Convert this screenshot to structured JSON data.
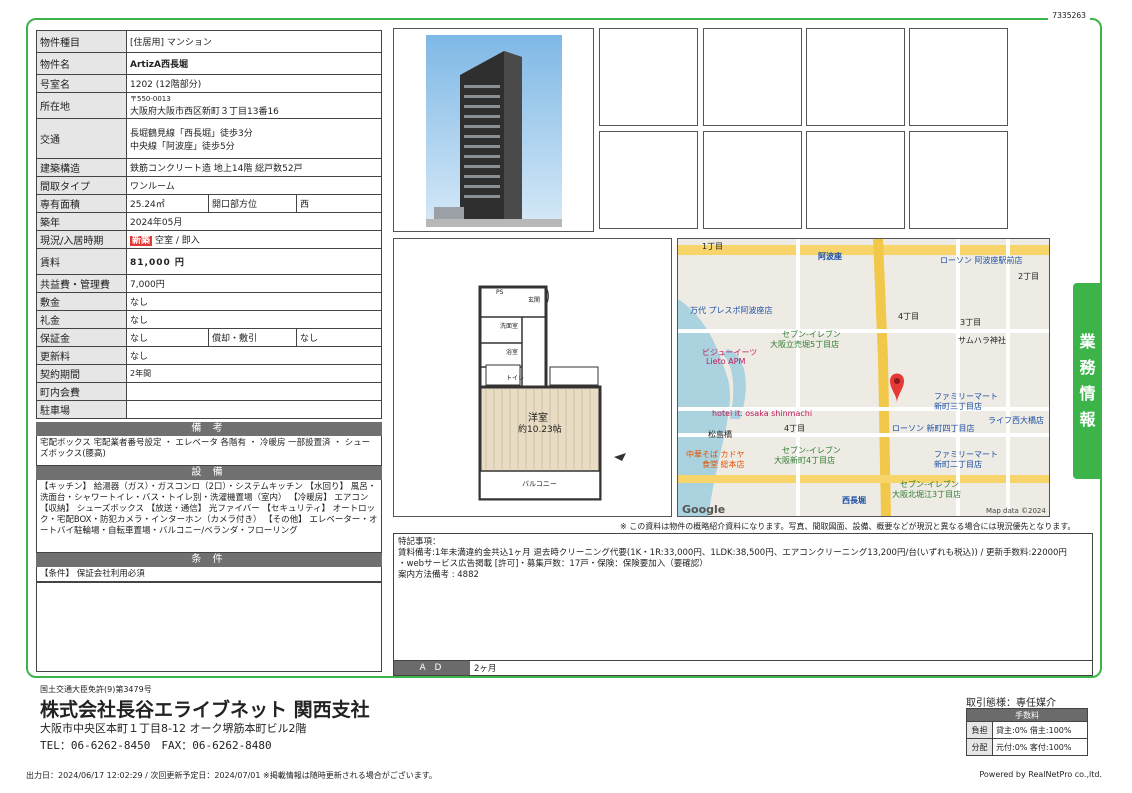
{
  "doc_id": "7335263",
  "property": {
    "type_label": "物件種目",
    "type_value": "[住居用] マンション",
    "name_label": "物件名",
    "name_value": "ArtizA西長堀",
    "room_label": "号室名",
    "room_value": "1202 (12階部分)",
    "address_label": "所在地",
    "postal": "〒550-0013",
    "address_value": "大阪府大阪市西区新町３丁目13番16",
    "access_label": "交通",
    "access_1": "長堀鶴見線「西長堀」徒歩3分",
    "access_2": "中央線「阿波座」徒歩5分",
    "structure_label": "建築構造",
    "structure_value": "鉄筋コンクリート造 地上14階 総戸数52戸",
    "layout_label": "間取タイプ",
    "layout_value": "ワンルーム",
    "area_label": "専有面積",
    "area_value": "25.24㎡",
    "orient_label": "開口部方位",
    "orient_value": "西",
    "built_label": "築年",
    "built_value": "2024年05月",
    "status_label": "現況/入居時期",
    "new_badge": "新築",
    "status_value": "空室 / 即入",
    "rent_label": "賃料",
    "rent_value": "81,000 円",
    "mgmt_label": "共益費・管理費",
    "mgmt_value": "7,000円",
    "deposit_label": "敷金",
    "deposit_value": "なし",
    "key_label": "礼金",
    "key_value": "なし",
    "guarantee_label": "保証金",
    "guarantee_value": "なし",
    "amort_label": "償却・敷引",
    "amort_value": "なし",
    "renewal_label": "更新料",
    "renewal_value": "なし",
    "contract_label": "契約期間",
    "contract_value": "2年間",
    "assoc_label": "町内会費",
    "assoc_value": "",
    "parking_label": "駐車場",
    "parking_value": ""
  },
  "remarks_head": "備 考",
  "remarks_text": "宅配ボックス 宅配業者番号設定 ・ エレベータ 各階有 ・ 冷暖房 一部設置済 ・ シューズボックス(腰高)",
  "equipment_head": "設 備",
  "equipment_text": "【キッチン】 給湯器（ガス）・ガスコンロ（2口）・システムキッチン 【水回り】 風呂・洗面台・シャワートイレ・バス・トイレ別・洗濯機置場（室内） 【冷暖房】 エアコン 【収納】 シューズボックス 【放送・通信】 光ファイバー 【セキュリティ】 オートロック・宅配BOX・防犯カメラ・インターホン（カメラ付き） 【その他】 エレベーター・オートバイ駐輪場・自転車置場・バルコニー/ベランダ・フローリング",
  "conditions_head": "条 件",
  "conditions_text": "【条件】 保証会社利用必須",
  "floorplan": {
    "room_label": "洋室",
    "room_size": "約10.23帖",
    "balcony": "バルコニー",
    "entrance": "玄関",
    "washroom": "洗面室",
    "bath": "浴室",
    "toilet": "トイレ",
    "ps": "PS"
  },
  "map_labels": {
    "awaza": "阿波座",
    "lawson1": "ローソン 阿波座駅前店",
    "chome1": "1丁目",
    "chome2": "2丁目",
    "mandai": "万代 プレスポ阿波座店",
    "seven1": "セブン-イレブン",
    "seven1b": "大阪立売堀5丁目店",
    "vie": "ビジューイーツ",
    "lieto": "Lieto APM",
    "samuhara": "サムハラ神社",
    "family1": "ファミリーマート",
    "family1b": "新町三丁目店",
    "hotel": "hotel it. osaka shinmachi",
    "chome4": "4丁目",
    "lawson2": "ローソン 新町四丁目店",
    "life": "ライフ西大橋店",
    "matsushima": "松島橋",
    "chuka": "中華そば カドヤ",
    "chuka_b": "食堂 総本店",
    "seven2": "セブン-イレブン",
    "seven2b": "大阪新町4丁目店",
    "family2": "ファミリーマート",
    "family2b": "新町二丁目店",
    "nishinagahori": "西長堀",
    "seven3": "セブン-イレブン",
    "seven3b": "大阪北堀江3丁目店",
    "google": "Google",
    "mapdata": "Map data ©2024",
    "chome3": "3丁目",
    "chome4b": "4丁目"
  },
  "notice": "※ この資料は物件の概略紹介資料になります。写真、間取図面、設備、概要などが現況と異なる場合には現況優先となります。",
  "special_head": "特記事項：",
  "special_1": "賃料備考:1年未満違約金共込1ヶ月 退去時クリーニング代要(1K・1R:33,000円、1LDK:38,500円、エアコンクリーニング13,200円/台(いずれも税込)) / 更新手数料:22000円",
  "special_2": "・webサービス広告掲載 [許可]・募集戸数：17戸・保険：保険要加入（要確認）",
  "special_3": "案内方法備考 : 4882",
  "ad_label": "A D",
  "ad_value": "2ヶ月",
  "side_tab": [
    "業",
    "務",
    "情",
    "報"
  ],
  "footer": {
    "license": "国土交通大臣免許(9)第3479号",
    "company": "株式会社長谷エライブネット 関西支社",
    "address": "大阪市中央区本町１丁目8-12 オーク堺筋本町ビル2階",
    "tel": "TEL：06-6262-8450　FAX：06-6262-8480",
    "trade_type": "取引態様：専任媒介",
    "fee_head": "手数料",
    "burden_label": "負担",
    "burden_value": "貸主:0% 借主:100%",
    "split_label": "分配",
    "split_value": "元付:0% 客付:100%",
    "output_date": "出力日：2024/06/17 12:02:29 / 次回更新予定日：2024/07/01 ※掲載情報は随時更新される場合がございます。",
    "powered": "Powered by RealNetPro co.,ltd."
  }
}
